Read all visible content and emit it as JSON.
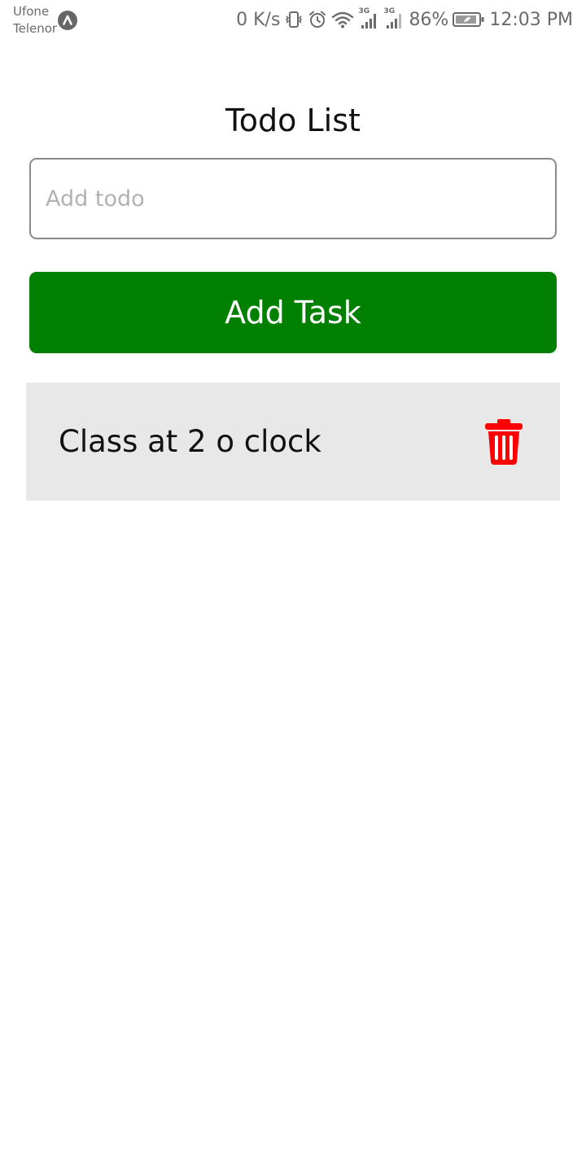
{
  "status_bar": {
    "carrier_1": "Ufone",
    "carrier_2": "Telenor",
    "net_speed": "0 K/s",
    "network_1": "3G",
    "network_2": "3G",
    "battery": "86%",
    "time": "12:03 PM",
    "icons": [
      "app-badge-icon",
      "vibrate-icon",
      "alarm-icon",
      "wifi-icon",
      "signal-icon",
      "signal-icon",
      "battery-icon"
    ]
  },
  "app": {
    "title": "Todo List",
    "input": {
      "placeholder": "Add todo",
      "value": ""
    },
    "add_button_label": "Add Task",
    "todos": [
      {
        "text": "Class at 2 o clock",
        "action_icon": "trash-icon"
      }
    ]
  },
  "colors": {
    "accent": "#008000",
    "delete": "#ff0000",
    "item_background": "#e8e8e8"
  }
}
